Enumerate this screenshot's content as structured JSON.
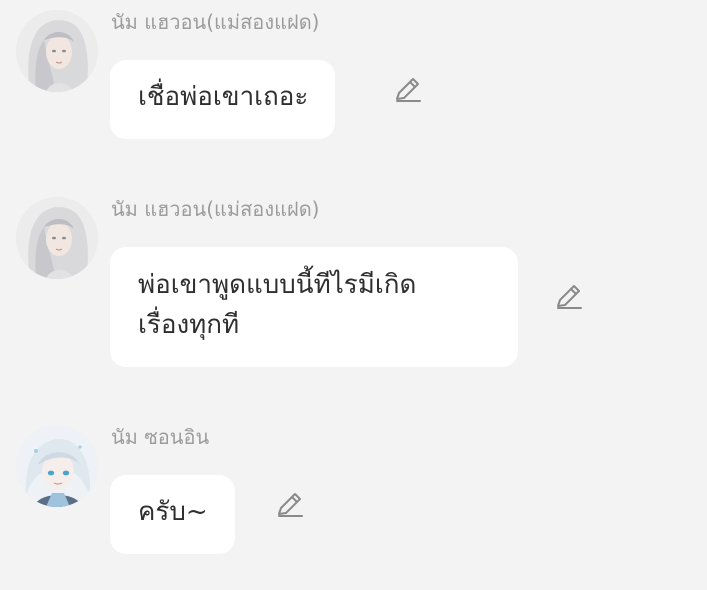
{
  "messages": [
    {
      "author": "นัม แฮวอน(แม่สองแฝด)",
      "text": "เชื่อพ่อเขาเถอะ",
      "avatar_icon": "avatar-white-hair-character",
      "edit_icon": "pencil-icon"
    },
    {
      "author": "นัม แฮวอน(แม่สองแฝด)",
      "text": "พ่อเขาพูดแบบนี้ทีไรมีเกิด\nเรื่องทุกที",
      "avatar_icon": "avatar-white-hair-character",
      "edit_icon": "pencil-icon"
    },
    {
      "author": "นัม ซอนอิน",
      "text": "ครับ~",
      "avatar_icon": "avatar-silver-hair-blue-eyes-character",
      "edit_icon": "pencil-icon"
    }
  ],
  "colors": {
    "background": "#f3f3f3",
    "bubble": "#ffffff",
    "name_text": "#9c9c9c",
    "message_text": "#2f2f2f",
    "icon": "#8a8a8a"
  }
}
